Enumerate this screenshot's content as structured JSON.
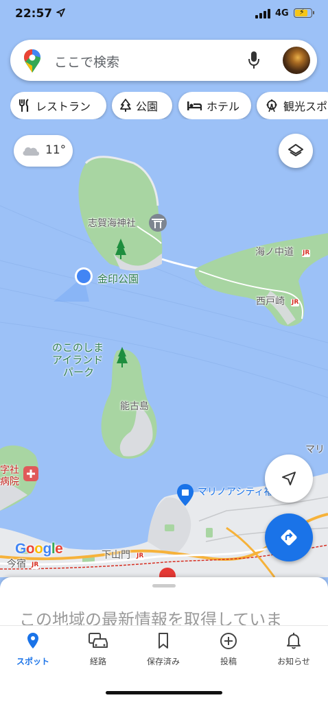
{
  "status_bar": {
    "time": "22:57",
    "network": "4G"
  },
  "search": {
    "placeholder": "ここで検索"
  },
  "chips": [
    {
      "label": "レストラン",
      "icon": "fork-knife-icon"
    },
    {
      "label": "公園",
      "icon": "tree-icon"
    },
    {
      "label": "ホテル",
      "icon": "bed-icon"
    },
    {
      "label": "観光スポ",
      "icon": "ferris-wheel-icon"
    }
  ],
  "weather": {
    "temperature": "11°",
    "icon": "cloud-icon"
  },
  "map_labels": {
    "shikaumi_shrine": "志賀海神社",
    "kinin_park": "金印公園",
    "uminonakamichi": "海ノ中道",
    "saitozaki": "西戸崎",
    "nokonoshima_park_line1": "のこのしま",
    "nokonoshima_park_line2": "アイランド",
    "nokonoshima_park_line3": "パーク",
    "nokonoshima": "能古島",
    "marino_city": "マリノアシティ福岡",
    "hospital_line1": "字社",
    "hospital_line2": "病院",
    "shimoyamato": "下山門",
    "imajuku": "今宿",
    "mari_edge": "マリ",
    "jr": "JR"
  },
  "google_logo": [
    "G",
    "o",
    "o",
    "g",
    "l",
    "e"
  ],
  "sheet": {
    "title": "この地域の最新情報を取得していま"
  },
  "bottom_nav": [
    {
      "label": "スポット",
      "icon": "location-pin-icon",
      "active": true
    },
    {
      "label": "経路",
      "icon": "car-icon",
      "active": false
    },
    {
      "label": "保存済み",
      "icon": "bookmark-icon",
      "active": false
    },
    {
      "label": "投稿",
      "icon": "plus-circle-icon",
      "active": false
    },
    {
      "label": "お知らせ",
      "icon": "bell-icon",
      "active": false
    }
  ],
  "colors": {
    "water": "#9cc1f7",
    "land": "#e8eaed",
    "park": "#a8d5a2",
    "accent": "#1a73e8",
    "road_orange": "#f6b23a",
    "rail_red": "#d62d20"
  }
}
